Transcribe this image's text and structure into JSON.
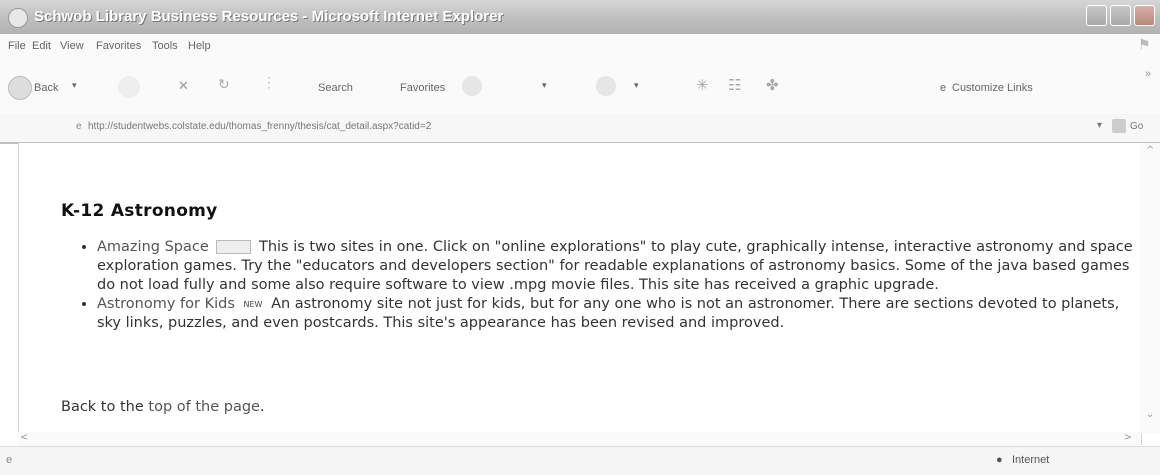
{
  "window": {
    "title": "Schwob Library Business Resources - Microsoft Internet Explorer"
  },
  "menu": [
    "File",
    "Edit",
    "View",
    "Favorites",
    "Tools",
    "Help"
  ],
  "toolbar": {
    "back": "Back",
    "search": "Search",
    "favorites": "Favorites",
    "customize_links": "Customize Links"
  },
  "address": {
    "url": "http://studentwebs.colstate.edu/thomas_frenny/thesis/cat_detail.aspx?catid=2",
    "go": "Go"
  },
  "page": {
    "heading": "K-12 Astronomy",
    "items": [
      {
        "link": "Amazing Space",
        "description": "This is two sites in one. Click on \"online explorations\" to play cute, graphically intense, interactive astronomy and space exploration games. Try the \"educators and developers section\" for readable explanations of astronomy basics. Some of the java based games do not load fully and some also require software to view .mpg movie files. This site has received a graphic upgrade."
      },
      {
        "link": "Astronomy for Kids",
        "badge": "NEW",
        "description": "An astronomy site not just for kids, but for any one who is not an astronomer. There are sections devoted to planets, sky links, puzzles, and even postcards. This site's appearance has been revised and improved."
      }
    ],
    "back_prefix": "Back to the",
    "back_link": "top of the page",
    "back_suffix": "."
  },
  "status": {
    "zone": "Internet"
  }
}
